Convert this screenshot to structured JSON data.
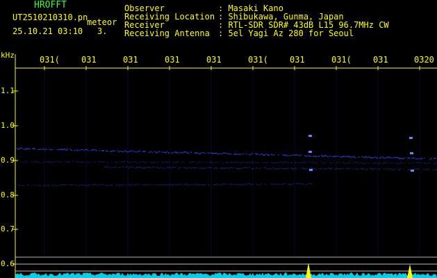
{
  "app": {
    "title": "HROFFT",
    "filename": "UT2510210310.pn",
    "tag": "meteor",
    "datetime": "25.10.21 03:10",
    "counter": "3."
  },
  "meta": [
    {
      "label": "Observer",
      "value": ": Masaki Kano"
    },
    {
      "label": "Receiving Location",
      "value": ": Shibukawa, Gunma, Japan"
    },
    {
      "label": "Receiver",
      "value": ": RTL-SDR SDR# 43dB L15 96.7MHz CW"
    },
    {
      "label": "Receiving Antenna",
      "value": ": 5el Yagi Az 280 for Seoul"
    }
  ],
  "axis": {
    "unit": "kHz",
    "y_ticks": [
      "1.1",
      "1.0",
      "0.9",
      "0.8",
      "0.7",
      "0.6"
    ],
    "x_ticks": [
      "031(",
      "031",
      "031",
      "031",
      "031",
      "031(",
      "031",
      "031(",
      "031",
      "0320"
    ]
  },
  "colors": {
    "text": "#ffff00",
    "title": "#33ff33",
    "trace": "#3344ff",
    "spectrum": "#00e5ff",
    "spike": "#ffff00"
  }
}
